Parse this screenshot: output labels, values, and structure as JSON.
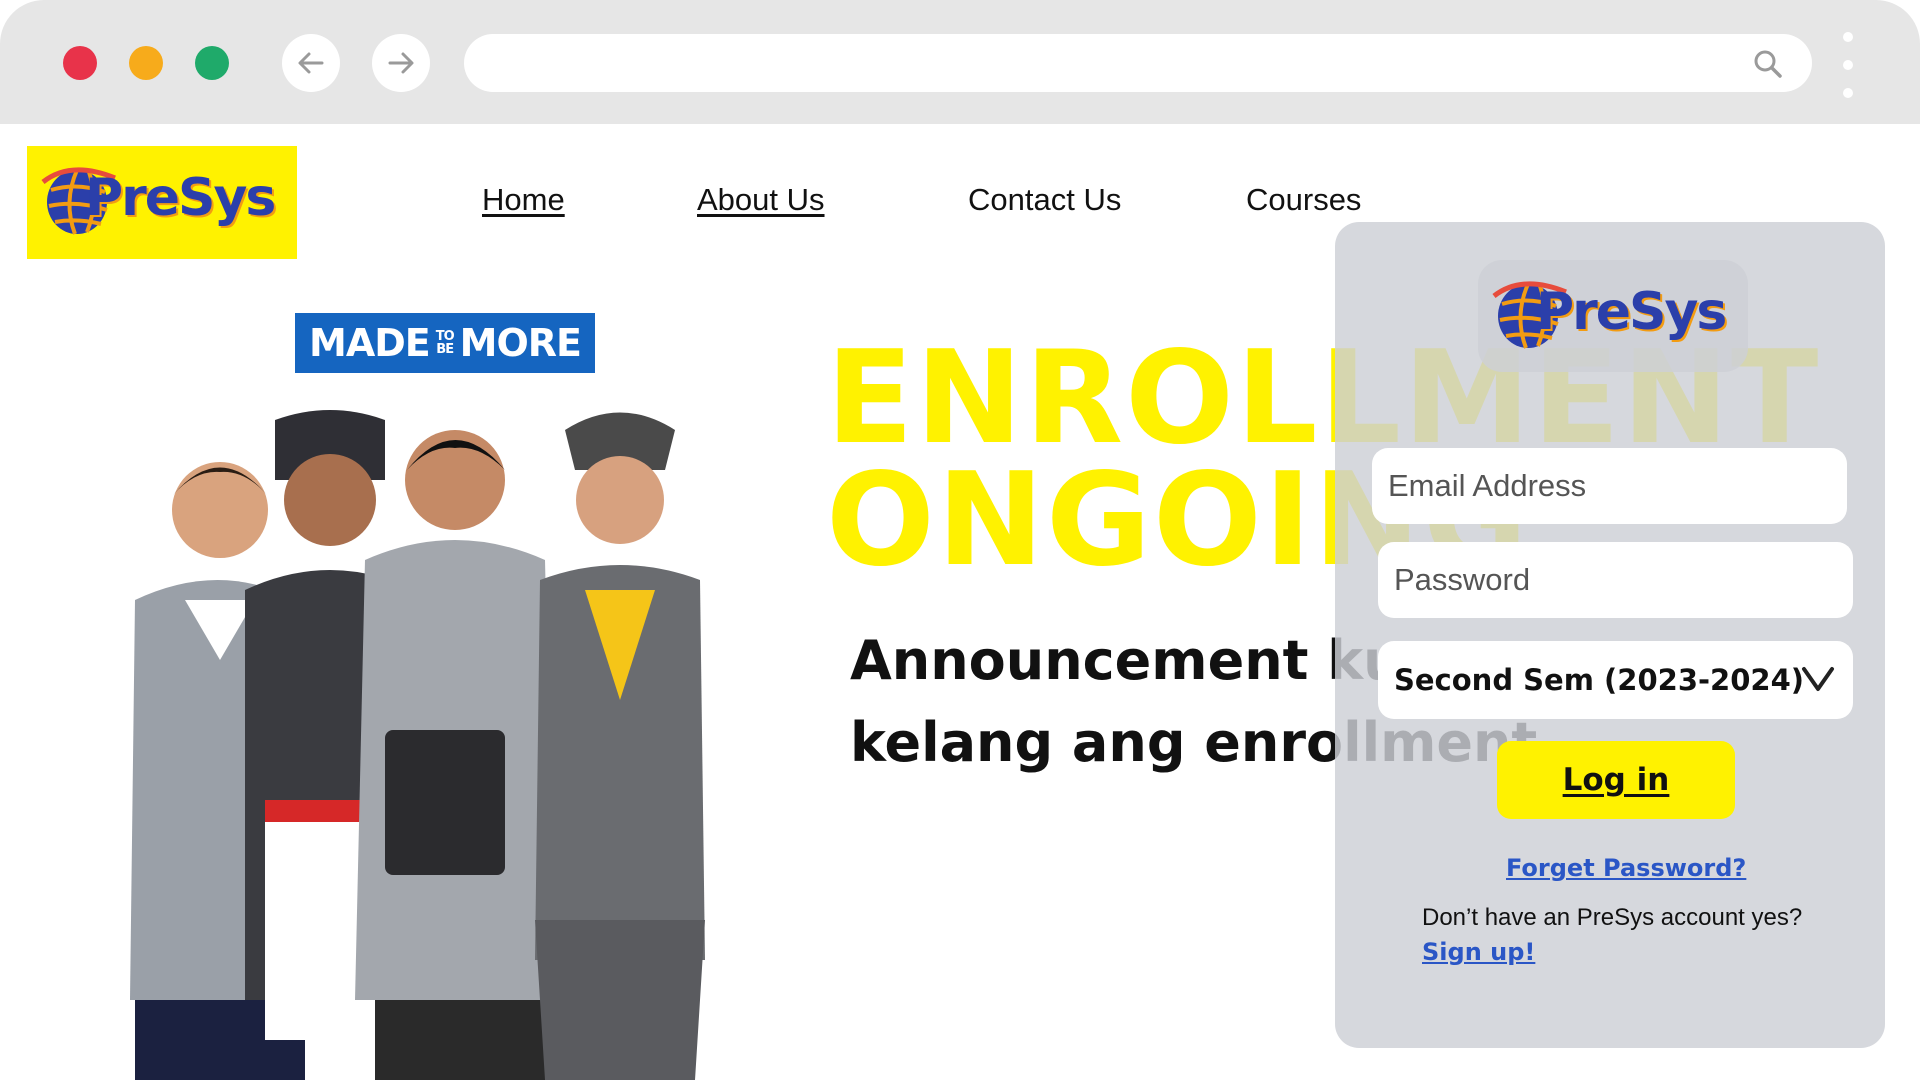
{
  "browser": {
    "url": "",
    "icons": [
      "close-dot",
      "minimize-dot",
      "maximize-dot",
      "back-arrow-icon",
      "forward-arrow-icon",
      "search-icon",
      "kebab-menu-icon"
    ]
  },
  "logo": {
    "text": "PreSys"
  },
  "nav": {
    "items": [
      "Home ",
      " About Us",
      "Contact Us",
      "Courses"
    ]
  },
  "badge": {
    "left": "MADE",
    "small_top": "TO",
    "small_bottom": "BE",
    "right": "MORE"
  },
  "hero": {
    "line1": "ENROLLMENT",
    "line2": "ONGOING",
    "announcement": "Announcement kung kelang ang enrollment"
  },
  "login": {
    "logo_text": "PreSys",
    "email_placeholder": "Email Address",
    "password_placeholder": "Password",
    "semester": "Second Sem (2023-2024)",
    "login_label": "Log in",
    "forget_label": "Forget Password?",
    "no_account_text": "Don’t have an PreSys account yes?",
    "signup_label": "Sign up!"
  },
  "colors": {
    "brand_yellow": "#fff200",
    "brand_blue": "#2b3faa",
    "link_blue": "#2a56c6",
    "badge_blue": "#1565c0"
  }
}
